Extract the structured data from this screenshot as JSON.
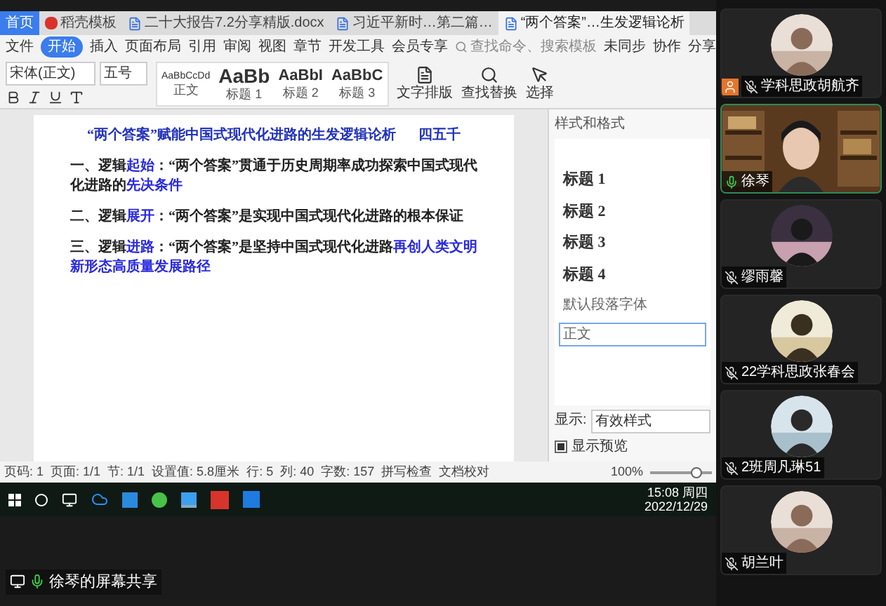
{
  "wps": {
    "tabs": [
      {
        "label": "首页",
        "kind": "home",
        "selected": false
      },
      {
        "label": "稻壳模板",
        "kind": "docer",
        "selected": false
      },
      {
        "label": "二十大报告7.2分享精版.docx",
        "kind": "doc",
        "selected": false
      },
      {
        "label": "习近平新时…第二篇…",
        "kind": "doc",
        "selected": false
      },
      {
        "label": "“两个答案”…生发逻辑论析",
        "kind": "doc",
        "selected": true
      }
    ],
    "menu": [
      {
        "label": "文件",
        "selected": false
      },
      {
        "label": "开始",
        "selected": true
      },
      {
        "label": "插入",
        "selected": false
      },
      {
        "label": "页面布局",
        "selected": false
      },
      {
        "label": "引用",
        "selected": false
      },
      {
        "label": "审阅",
        "selected": false
      },
      {
        "label": "视图",
        "selected": false
      },
      {
        "label": "章节",
        "selected": false
      },
      {
        "label": "开发工具",
        "selected": false
      },
      {
        "label": "会员专享",
        "selected": false
      }
    ],
    "search": {
      "placeholder": "查找命令、搜索模板"
    },
    "actions": [
      "未同步",
      "协作",
      "分享"
    ],
    "ribbon": {
      "font": "宋体(正文)",
      "size": "五号",
      "styles": [
        {
          "preview": "AaBbCcDd",
          "label": "正文",
          "kind": "small"
        },
        {
          "preview": "AaBb",
          "label": "标题 1",
          "kind": "big"
        },
        {
          "preview": "AaBbI",
          "label": "标题 2",
          "kind": "mid"
        },
        {
          "preview": "AaBbC",
          "label": "标题 3",
          "kind": "mid"
        }
      ],
      "tools": [
        "文字排版",
        "查找替换",
        "选择"
      ]
    },
    "document": {
      "title": "“两个答案”赋能中国式现代化进路的生发逻辑论析",
      "author": "四五千",
      "paragraphs": [
        [
          {
            "text": "一、逻辑",
            "blue": false
          },
          {
            "text": "起始",
            "blue": true
          },
          {
            "text": "：“两个答案”贯通于历史周期率成功探索中国式现代化进路的",
            "blue": false
          },
          {
            "text": "先决条件",
            "blue": true
          }
        ],
        [
          {
            "text": "二、逻辑",
            "blue": false
          },
          {
            "text": "展开",
            "blue": true
          },
          {
            "text": "：“两个答案”是实现中国式现代化进路的根本保证",
            "blue": false
          }
        ],
        [
          {
            "text": "三、逻辑",
            "blue": false
          },
          {
            "text": "进路",
            "blue": true
          },
          {
            "text": "：“两个答案”是坚持中国式现代化进路",
            "blue": false
          },
          {
            "text": "再创人类文明新形态高质量发展路径",
            "blue": true
          }
        ]
      ]
    },
    "styles_pane": {
      "title": "样式和格式",
      "items": [
        {
          "label": "标题 1",
          "kind": "h1",
          "selected": false
        },
        {
          "label": "标题 2",
          "kind": "h2",
          "selected": false
        },
        {
          "label": "标题 3",
          "kind": "h3",
          "selected": false
        },
        {
          "label": "标题 4",
          "kind": "h4",
          "selected": false
        },
        {
          "label": "默认段落字体",
          "kind": "plain",
          "selected": false
        },
        {
          "label": "正文",
          "kind": "plain",
          "selected": true
        }
      ],
      "show_label": "显示:",
      "show_value": "有效样式",
      "preview": {
        "label": "显示预览",
        "checked": true
      }
    },
    "status_bar": [
      "页码: 1",
      "页面: 1/1",
      "节: 1/1",
      "设置值: 5.8厘米",
      "行: 5",
      "列: 40",
      "字数: 157",
      "拼写检查",
      "文档校对"
    ],
    "zoom": {
      "reading": "100%",
      "level": 0.75
    }
  },
  "taskbar": {
    "time": "15:08 周四",
    "date": "2022/12/29"
  },
  "share_label": "徐琴的屏幕共享",
  "participants": [
    {
      "name": "学科思政胡航齐",
      "kind": "avatar",
      "host": true,
      "muted": true,
      "active": false
    },
    {
      "name": "徐琴",
      "kind": "video",
      "host": false,
      "muted": false,
      "active": true
    },
    {
      "name": "缪雨馨",
      "kind": "avatar",
      "host": false,
      "muted": true,
      "active": false
    },
    {
      "name": "22学科思政张春会",
      "kind": "avatar",
      "host": false,
      "muted": true,
      "active": false
    },
    {
      "name": "2班周凡琳51",
      "kind": "avatar",
      "host": false,
      "muted": true,
      "active": false
    },
    {
      "name": "胡兰叶",
      "kind": "avatar",
      "host": false,
      "muted": true,
      "active": false
    }
  ]
}
